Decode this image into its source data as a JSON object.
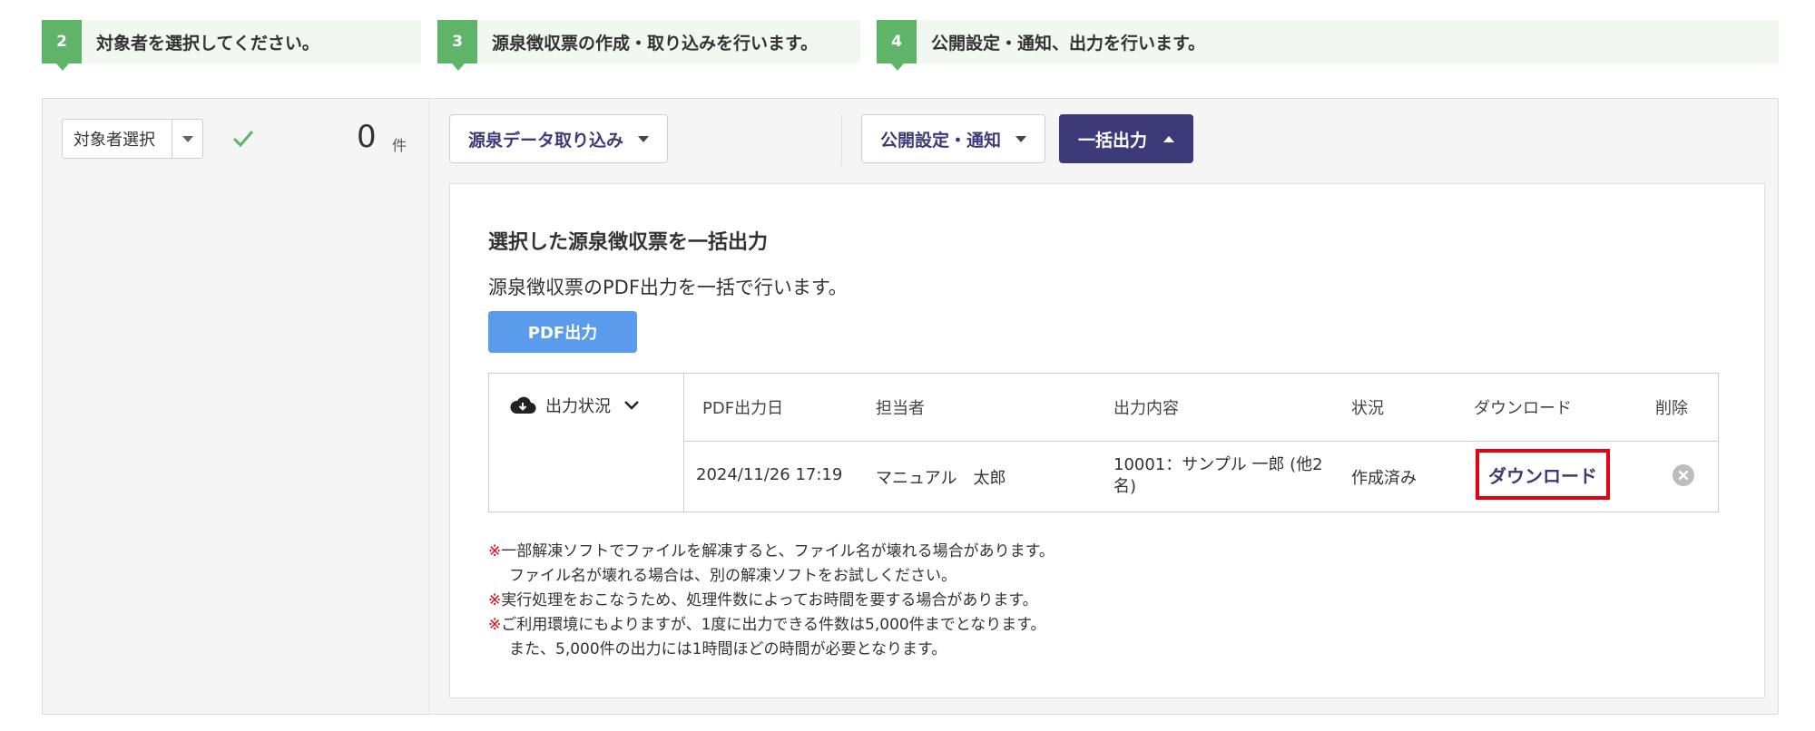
{
  "steps": [
    {
      "num": "2",
      "label": "対象者を選択してください。"
    },
    {
      "num": "3",
      "label": "源泉徴収票の作成・取り込みを行います。"
    },
    {
      "num": "4",
      "label": "公開設定・通知、出力を行います。"
    }
  ],
  "left_panel": {
    "select_label": "対象者選択",
    "count": "0",
    "count_unit": "件"
  },
  "toolbar": {
    "import_label": "源泉データ取り込み",
    "publish_label": "公開設定・通知",
    "bulk_output_label": "一括出力"
  },
  "content": {
    "title": "選択した源泉徴収票を一括出力",
    "description": "源泉徴収票のPDF出力を一括で行います。",
    "pdf_button": "PDF出力",
    "status_toggle": "出力状況",
    "headers": [
      "PDF出力日",
      "担当者",
      "出力内容",
      "状況",
      "ダウンロード",
      "削除"
    ],
    "row": {
      "date": "2024/11/26 17:19",
      "person": "マニュアル　太郎",
      "content_line1": "10001：サンプル 一郎 (他2",
      "content_line2": "名)",
      "status": "作成済み",
      "download": "ダウンロード"
    },
    "notes": [
      {
        "mark": "※",
        "text": "一部解凍ソフトでファイルを解凍すると、ファイル名が壊れる場合があります。"
      },
      {
        "mark": "",
        "text": "ファイル名が壊れる場合は、別の解凍ソフトをお試しください。"
      },
      {
        "mark": "※",
        "text": "実行処理をおこなうため、処理件数によってお時間を要する場合があります。"
      },
      {
        "mark": "※",
        "text": "ご利用環境にもよりますが、1度に出力できる件数は5,000件までとなります。"
      },
      {
        "mark": "",
        "text": "また、5,000件の出力には1時間ほどの時間が必要となります。"
      }
    ]
  },
  "colors": {
    "step_green": "#5fb46a",
    "primary_navy": "#3d3a7a",
    "pdf_blue": "#5b9bec",
    "highlight_red": "#e60012"
  }
}
